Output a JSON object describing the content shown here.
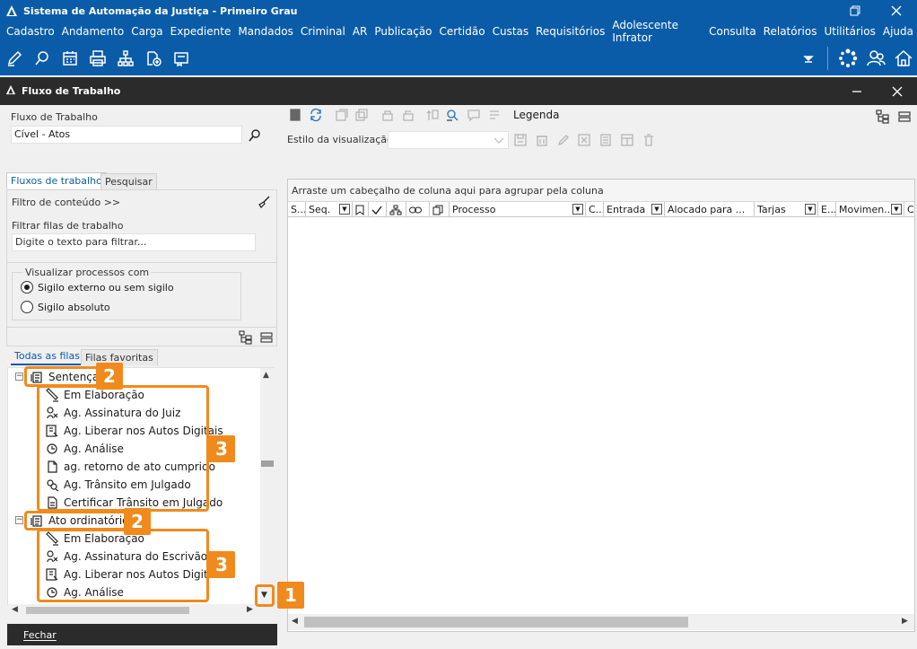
{
  "window": {
    "title": "Sistema de Automação da Justiça - Primeiro Grau"
  },
  "menu": [
    "Cadastro",
    "Andamento",
    "Carga",
    "Expediente",
    "Mandados",
    "Criminal",
    "AR",
    "Publicação",
    "Certidão",
    "Custas",
    "Requisitórios",
    "Adolescente Infrator",
    "Consulta",
    "Relatórios",
    "Utilitários",
    "Ajuda"
  ],
  "toolbar": {
    "icons": [
      "edit-icon",
      "search-process-icon",
      "calendar-icon",
      "print-icon",
      "org-chart-icon",
      "add-document-icon",
      "certificate-icon"
    ],
    "right_icons": [
      "dropdown-arrow-icon",
      "loading-icon",
      "users-icon",
      "home-icon"
    ]
  },
  "panel": {
    "title": "Fluxo de Trabalho"
  },
  "left": {
    "fluxo_label": "Fluxo de Trabalho",
    "fluxo_value": "Cível - Atos",
    "tabs": [
      "Fluxos de trabalho",
      "Pesquisar"
    ],
    "filtro_conteudo": "Filtro de conteúdo >>",
    "filtrar_label": "Filtrar filas de trabalho",
    "filtrar_placeholder": "Digite o texto para filtrar...",
    "visualizar_label": "Visualizar processos com",
    "radio_externo": "Sigilo externo ou sem sigilo",
    "radio_absoluto": "Sigilo absoluto",
    "queue_tabs": [
      "Todas as filas",
      "Filas favoritas"
    ],
    "close_button": "Fechar"
  },
  "tree": {
    "groups": [
      {
        "label": "Sentença",
        "items": [
          "Em Elaboração",
          "Ag. Assinatura do Juiz",
          "Ag. Liberar nos Autos Digitais",
          "Ag. Análise",
          "ag. retorno de ato cumprido",
          "Ag. Trânsito em Julgado",
          "Certificar Trânsito em Julgado"
        ]
      },
      {
        "label": "Ato ordinatório",
        "items": [
          "Em Elaboração",
          "Ag. Assinatura do Escrivão",
          "Ag. Liberar nos Autos Digitais",
          "Ag. Análise"
        ]
      }
    ]
  },
  "right": {
    "legenda": "Legenda",
    "estilo_label": "Estilo da visualização",
    "group_hint": "Arraste um cabeçalho de coluna aqui para agrupar pela coluna",
    "columns": [
      "S...",
      "Seq.",
      "",
      "",
      "",
      "",
      "",
      "Processo",
      "C...",
      "Entrada",
      "Alocado para ...",
      "Tarjas",
      "E...",
      "Movimen...",
      "C"
    ]
  },
  "callouts": {
    "one": "1",
    "two_a": "2",
    "two_b": "2",
    "three_a": "3",
    "three_b": "3"
  },
  "colors": {
    "brand": "#0b5ca8",
    "dark_header": "#2b2b2b",
    "callout": "#f08a1d"
  }
}
